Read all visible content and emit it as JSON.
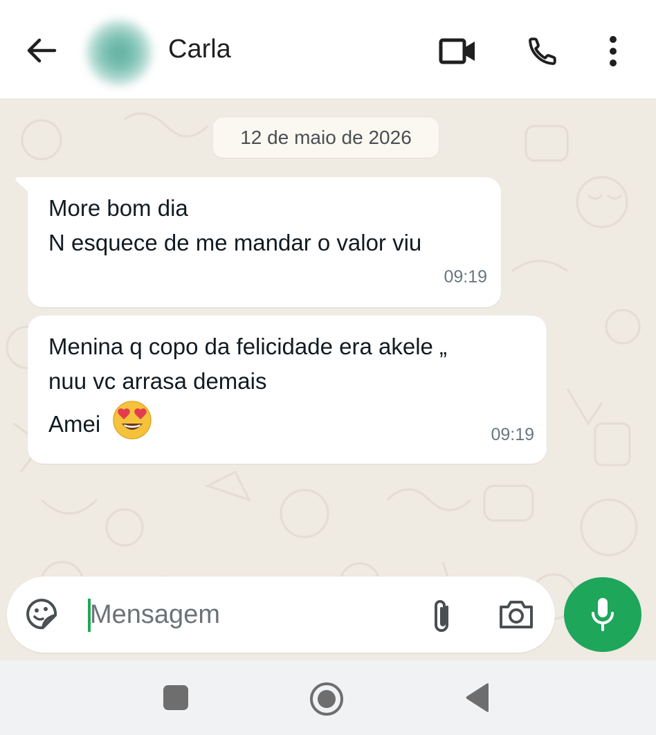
{
  "header": {
    "contact_name": "Carla",
    "icons": {
      "back": "arrow-left-icon",
      "video": "video-camera-icon",
      "call": "phone-icon",
      "menu": "more-vertical-icon"
    }
  },
  "chat": {
    "date_chip": "12 de maio de 2026",
    "messages": [
      {
        "lines": [
          "More bom dia",
          "N esquece de me mandar o valor viu"
        ],
        "time": "09:19"
      },
      {
        "lines": [
          "Menina q copo da felicidade era akele  „",
          "nuu vc arrasa demais",
          "Amei"
        ],
        "emoji": "😍",
        "time": "09:19"
      }
    ]
  },
  "composer": {
    "placeholder": "Mensagem",
    "icons": {
      "sticker": "sticker-emoji-icon",
      "attach": "paperclip-icon",
      "camera": "camera-icon",
      "mic": "microphone-icon"
    }
  },
  "system_nav": {
    "icons": {
      "recents": "square-icon",
      "home": "circle-icon",
      "back": "triangle-back-icon"
    }
  },
  "colors": {
    "accent": "#1ea65a",
    "chat_bg": "#efeae2",
    "bubble": "#ffffff",
    "header_bg": "#ffffff",
    "navbar_bg": "#f1f2f4"
  }
}
